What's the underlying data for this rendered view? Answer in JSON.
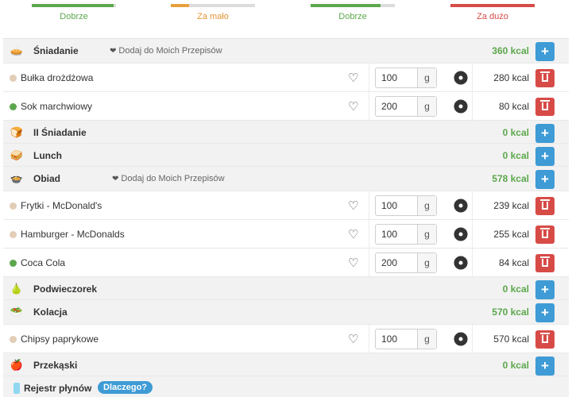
{
  "status": [
    {
      "label": "Dobrze",
      "fill_pct": 97,
      "fill_color": "#5ca74c",
      "text_color": "#5ca74c"
    },
    {
      "label": "Za mało",
      "fill_pct": 22,
      "fill_color": "#e8a13a",
      "text_color": "#e29434"
    },
    {
      "label": "Dobrze",
      "fill_pct": 83,
      "fill_color": "#5ca74c",
      "text_color": "#5ca74c"
    },
    {
      "label": "Za dużo",
      "fill_pct": 100,
      "fill_color": "#d74b47",
      "text_color": "#d74b47"
    }
  ],
  "add_symbol": "+",
  "fav_label": "Dodaj do Moich Przepisów",
  "unit": "g",
  "meals": [
    {
      "name": "Śniadanie",
      "icon": "pie-icon",
      "glyph": "🥧",
      "kcal": "360 kcal",
      "show_fav": true,
      "items": [
        {
          "name": "Bułka drożdżowa",
          "dot": "#e2cdb7",
          "qty": "100",
          "kcal": "280 kcal"
        },
        {
          "name": "Sok marchwiowy",
          "dot": "#5ca74c",
          "qty": "200",
          "kcal": "80 kcal"
        }
      ]
    },
    {
      "name": "II Śniadanie",
      "icon": "toast-icon",
      "glyph": "🍞",
      "kcal": "0 kcal",
      "show_fav": false,
      "items": []
    },
    {
      "name": "Lunch",
      "icon": "sandwich-icon",
      "glyph": "🥪",
      "kcal": "0 kcal",
      "show_fav": false,
      "items": []
    },
    {
      "name": "Obiad",
      "icon": "pot-icon",
      "glyph": "🍲",
      "kcal": "578 kcal",
      "show_fav": true,
      "items": [
        {
          "name": "Frytki - McDonald's",
          "dot": "#e2cdb7",
          "qty": "100",
          "kcal": "239 kcal"
        },
        {
          "name": "Hamburger - McDonalds",
          "dot": "#e2cdb7",
          "qty": "100",
          "kcal": "255 kcal"
        },
        {
          "name": "Coca Cola",
          "dot": "#5ca74c",
          "qty": "200",
          "kcal": "84 kcal"
        }
      ]
    },
    {
      "name": "Podwieczorek",
      "icon": "pear-icon",
      "glyph": "🍐",
      "kcal": "0 kcal",
      "show_fav": false,
      "items": []
    },
    {
      "name": "Kolacja",
      "icon": "salad-icon",
      "glyph": "🥗",
      "kcal": "570 kcal",
      "show_fav": false,
      "items": [
        {
          "name": "Chipsy paprykowe",
          "dot": "#e2cdb7",
          "qty": "100",
          "kcal": "570 kcal"
        }
      ]
    },
    {
      "name": "Przekąski",
      "icon": "apple-icon",
      "glyph": "🍎",
      "kcal": "0 kcal",
      "show_fav": false,
      "items": []
    }
  ],
  "fluids": {
    "label": "Rejestr płynów",
    "badge": "Dlaczego?"
  }
}
